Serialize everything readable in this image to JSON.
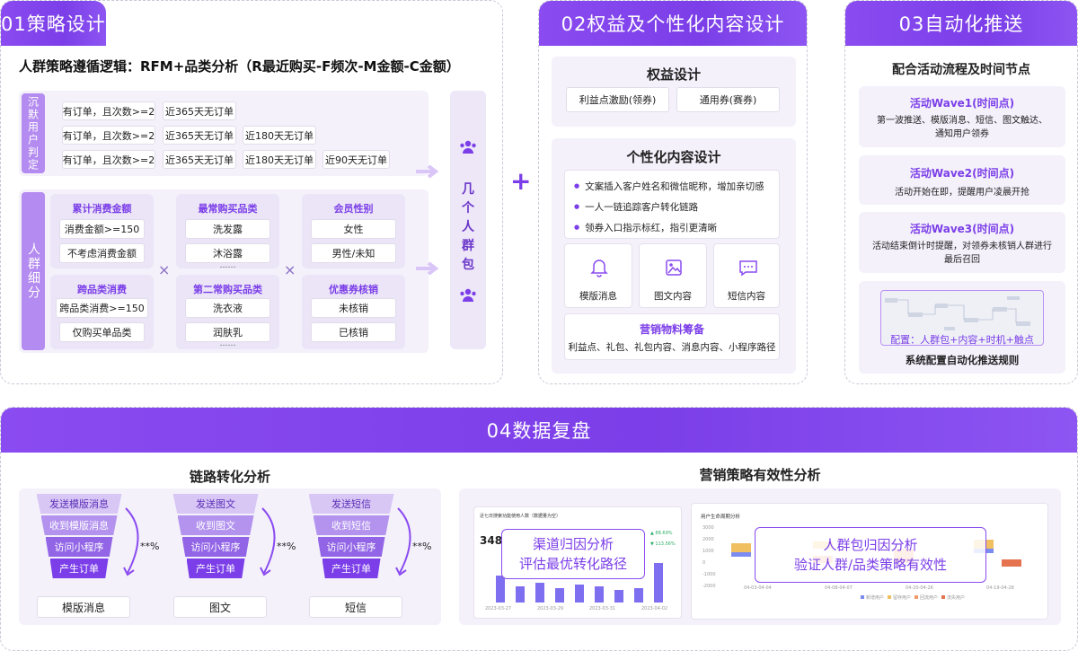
{
  "s1": {
    "title": "01策略设计",
    "logic": "人群策略遵循逻辑：RFM+品类分析（R最近购买-F频次-M金额-C金额）",
    "silent_label": "沉默用户判定",
    "rows": [
      [
        "有订单，且次数>=2",
        "近365天无订单"
      ],
      [
        "有订单，且次数>=2",
        "近365天无订单",
        "近180天无订单"
      ],
      [
        "有订单，且次数>=2",
        "近365天无订单",
        "近180天无订单",
        "近90天无订单"
      ]
    ],
    "segment_label": "人群细分",
    "groups": {
      "g1": {
        "title": "累计消费金额",
        "items": [
          "消费金额>=150",
          "不考虑消费金额"
        ]
      },
      "g2": {
        "title": "最常购买品类",
        "items": [
          "洗发露",
          "沐浴露",
          "……"
        ]
      },
      "g3": {
        "title": "会员性别",
        "items": [
          "女性",
          "男性/未知"
        ]
      },
      "g4": {
        "title": "跨品类消费",
        "items": [
          "跨品类消费>=150",
          "仅购买单品类"
        ]
      },
      "g5": {
        "title": "第二常购买品类",
        "items": [
          "洗衣液",
          "润肤乳",
          "……"
        ]
      },
      "g6": {
        "title": "优惠券核销",
        "items": [
          "未核销",
          "已核销"
        ]
      }
    },
    "times": "×",
    "packs_label": "几个人群包",
    "plus": "+"
  },
  "s2": {
    "title": "02权益及个性化内容设计",
    "benefit_title": "权益设计",
    "benefits": [
      "利益点激励(领券)",
      "通用券(赛券)"
    ],
    "content_title": "个性化内容设计",
    "bullets": [
      "文案插入客户姓名和微信昵称，增加亲切感",
      "一人一链追踪客户转化链路",
      "领券入口指示标红，指引更清晰"
    ],
    "channels": [
      {
        "icon": "bell-icon",
        "label": "模版消息"
      },
      {
        "icon": "image-icon",
        "label": "图文内容"
      },
      {
        "icon": "message-icon",
        "label": "短信内容"
      }
    ],
    "materials_title": "营销物料筹备",
    "materials": "利益点、礼包、礼包内容、消息内容、小程序路径"
  },
  "s3": {
    "title": "03自动化推送",
    "subtitle": "配合活动流程及时间节点",
    "waves": [
      {
        "title": "活动Wave1(时间点)",
        "desc": "第一波推送、模版消息、短信、图文触达、通知用户领券"
      },
      {
        "title": "活动Wave2(时间点)",
        "desc": "活动开始在即，提醒用户凌晨开抢"
      },
      {
        "title": "活动Wave3(时间点)",
        "desc": "活动结束倒计时提醒，对领券未核销人群进行最后召回"
      }
    ],
    "config_caption": "配置：人群包+内容+时机+触点",
    "config_footer": "系统配置自动化推送规则"
  },
  "s4": {
    "title": "04数据复盘",
    "funnel_section": "链路转化分析",
    "funnels": [
      {
        "steps": [
          "发送模版消息",
          "收到模版消息",
          "访问小程序",
          "产生订单"
        ],
        "rate": "**%",
        "label": "模版消息"
      },
      {
        "steps": [
          "发送图文",
          "收到图文",
          "访问小程序",
          "产生订单"
        ],
        "rate": "**%",
        "label": "图文"
      },
      {
        "steps": [
          "发送短信",
          "收到短信",
          "访问小程序",
          "产生订单"
        ],
        "rate": "**%",
        "label": "短信"
      }
    ],
    "strategy_section": "营销策略有效性分析",
    "chart1": {
      "title": "近七日搜索功能使用人数（数据量为空）",
      "value": "348",
      "overlay": [
        "渠道归因分析",
        "评估最优转化路径"
      ],
      "stat1": "▲ 88.69%",
      "stat2": "▼ 113.56%",
      "x_labels": [
        "2023-03-27",
        "2023-03-29",
        "2023-03-31",
        "2023-04-02"
      ]
    },
    "chart2": {
      "title": "用户生命周期分析",
      "overlay": [
        "人群包归因分析",
        "验证人群/品类策略有效性"
      ],
      "y_labels": [
        "3000",
        "2000",
        "1000",
        "0",
        "-1000",
        "-2000"
      ],
      "x_labels": [
        "04-03-04-04",
        "04-08-04-07",
        "04-20-04-26",
        "04-19-04-28"
      ],
      "legend": [
        "新增用户",
        "留存用户",
        "回流用户",
        "流失用户"
      ]
    }
  },
  "colors": {
    "primary": "#7b3ee8",
    "light": "#f4f1fb"
  }
}
